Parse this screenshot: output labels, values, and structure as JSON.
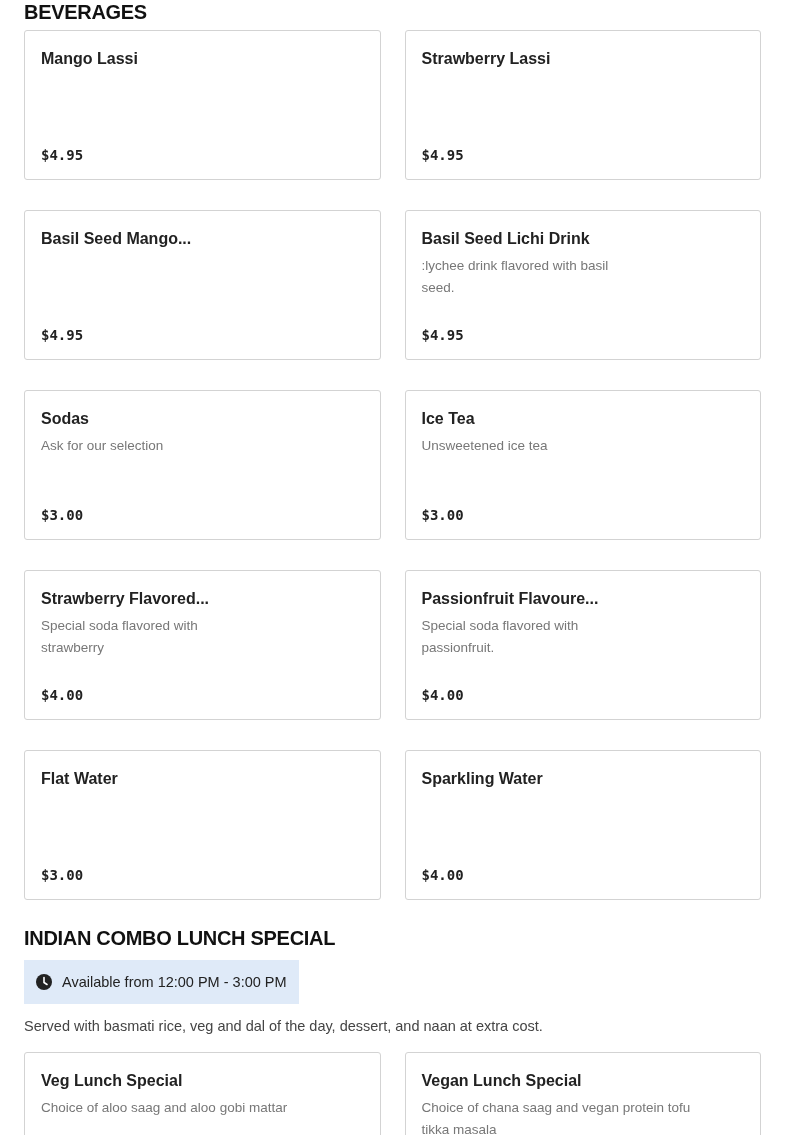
{
  "sections": [
    {
      "title": "BEVERAGES",
      "items": [
        {
          "name": "Mango Lassi",
          "price": "$4.95"
        },
        {
          "name": "Strawberry Lassi",
          "price": "$4.95"
        },
        {
          "name": "Basil Seed Mango...",
          "price": "$4.95"
        },
        {
          "name": "Basil Seed Lichi Drink",
          "description": ":lychee drink flavored with basil seed.",
          "price": "$4.95"
        },
        {
          "name": "Sodas",
          "description": "Ask for our selection",
          "price": "$3.00"
        },
        {
          "name": "Ice Tea",
          "description": "Unsweetened ice tea",
          "price": "$3.00"
        },
        {
          "name": "Strawberry Flavored...",
          "description": "Special soda flavored with strawberry",
          "price": "$4.00"
        },
        {
          "name": "Passionfruit Flavoure...",
          "description": "Special soda flavored with passionfruit.",
          "price": "$4.00"
        },
        {
          "name": "Flat Water",
          "price": "$3.00"
        },
        {
          "name": "Sparkling Water",
          "price": "$4.00"
        }
      ]
    },
    {
      "title": "INDIAN COMBO LUNCH SPECIAL",
      "availability": "Available from 12:00 PM - 3:00 PM",
      "note": "Served with basmati rice, veg and dal of the day, dessert, and naan at extra cost.",
      "items": [
        {
          "name": "Veg Lunch Special",
          "description": "Choice of aloo saag and aloo gobi mattar"
        },
        {
          "name": "Vegan Lunch Special",
          "description": "Choice of chana saag and vegan protein tofu tikka masala"
        }
      ]
    }
  ]
}
